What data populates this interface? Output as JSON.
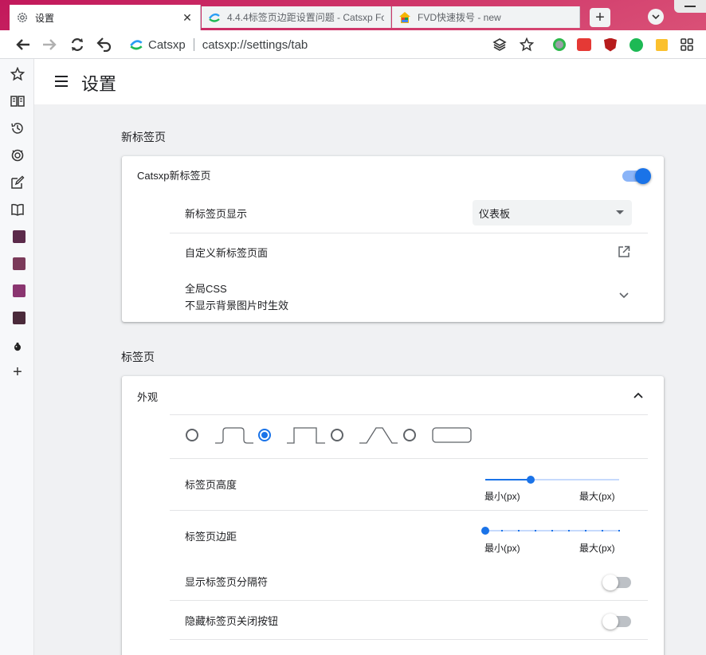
{
  "browser": {
    "tabs": [
      {
        "title": "设置",
        "active": true,
        "icon": "gear-icon"
      },
      {
        "title": "4.4.4标签页边距设置问题 - Catsxp Fo",
        "active": false,
        "icon": "catsxp-logo-icon"
      },
      {
        "title": "FVD快速拨号 - new",
        "active": false,
        "icon": "fvd-icon"
      }
    ],
    "new_tab_symbol": "+",
    "close_symbol": "✕",
    "brand": "Catsxp",
    "url": "catsxp://settings/tab",
    "extension_colors": [
      "#9aa0a6",
      "#e53935",
      "#b71c1c",
      "#1db954",
      "#fbc02d"
    ]
  },
  "sidebar": {
    "icons": [
      "star-icon",
      "reader-icon",
      "history-icon",
      "bug-icon",
      "edit-icon",
      "book-icon"
    ],
    "shortcut_colors": [
      "#5b2a4a",
      "#7b3a5a",
      "#8a3570",
      "#4b2a3a"
    ],
    "add_symbol": "+"
  },
  "header": {
    "title": "设置"
  },
  "section_newtab": {
    "title": "新标签页",
    "main_label": "Catsxp新标签页",
    "main_toggle_on": true,
    "display_label": "新标签页显示",
    "display_value": "仪表板",
    "custom_label": "自定义新标签页面",
    "css_label": "全局CSS",
    "css_sublabel": "不显示背景图片时生效"
  },
  "section_tabs": {
    "title": "标签页",
    "appearance_label": "外观",
    "tab_styles_selected_index": 0,
    "height": {
      "label": "标签页高度",
      "min_label": "最小(px)",
      "max_label": "最大(px)",
      "value_fraction": 0.34
    },
    "margin": {
      "label": "标签页边距",
      "min_label": "最小(px)",
      "max_label": "最大(px)",
      "value_fraction": 0.0,
      "steps": 8
    },
    "separator": {
      "label": "显示标签页分隔符",
      "on": false
    },
    "hide_close": {
      "label": "隐藏标签页关闭按钮",
      "on": false
    }
  }
}
